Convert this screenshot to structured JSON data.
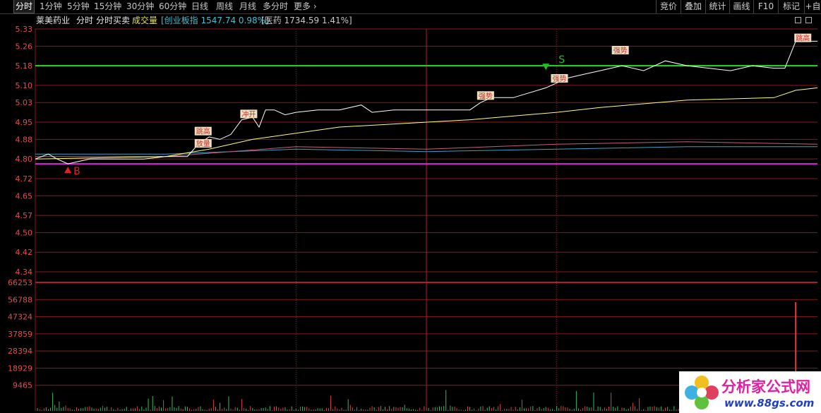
{
  "toolbar": {
    "periods": [
      "分时",
      "1分钟",
      "5分钟",
      "15分钟",
      "30分钟",
      "60分钟",
      "日线",
      "周线",
      "月线",
      "多分时",
      "更多"
    ],
    "right_tools": [
      "竞价",
      "叠加",
      "统计",
      "画线",
      "F10",
      "标记",
      "+自"
    ]
  },
  "info": {
    "stock_name": "莱美药业",
    "tab_time": "分时",
    "tab_trade": "分时买卖",
    "volume_label": "成交量",
    "index1": "[创业板指 1547.74 0.98%]",
    "index2": "[医药 1734.59 1.41%]"
  },
  "price_axis": [
    "5.33",
    "5.26",
    "5.18",
    "5.10",
    "5.03",
    "4.95",
    "4.88",
    "4.80",
    "4.72",
    "4.65",
    "4.57",
    "4.50",
    "4.42",
    "4.34"
  ],
  "volume_axis": [
    "66253",
    "56788",
    "47324",
    "37859",
    "28394",
    "18929",
    "9465"
  ],
  "markers": {
    "buy": "B",
    "sell": "S",
    "labels": [
      "放量",
      "跳高",
      "冲开",
      "强势",
      "强势",
      "强势",
      "跳高"
    ]
  },
  "watermark": {
    "title": "分析家公式网",
    "url": "www.88gs.com"
  },
  "colors": {
    "grid": "#8b1a1a",
    "price_line": "#ffffff",
    "avg_line": "#ffff80",
    "green_level": "#22dd22",
    "magenta_level": "#dd22dd",
    "axis_text": "#e05050"
  },
  "chart_data": {
    "type": "line",
    "title": "",
    "y_range": [
      4.34,
      5.33
    ],
    "price_series": [
      [
        0,
        4.8
      ],
      [
        6,
        4.82
      ],
      [
        10,
        4.8
      ],
      [
        15,
        4.78
      ],
      [
        20,
        4.79
      ],
      [
        25,
        4.8
      ],
      [
        30,
        4.8
      ],
      [
        40,
        4.8
      ],
      [
        50,
        4.8
      ],
      [
        60,
        4.81
      ],
      [
        70,
        4.81
      ],
      [
        75,
        4.86
      ],
      [
        80,
        4.89
      ],
      [
        85,
        4.88
      ],
      [
        90,
        4.9
      ],
      [
        95,
        4.96
      ],
      [
        100,
        4.97
      ],
      [
        103,
        4.93
      ],
      [
        106,
        5.0
      ],
      [
        110,
        5.0
      ],
      [
        115,
        4.98
      ],
      [
        120,
        4.99
      ],
      [
        130,
        5.0
      ],
      [
        140,
        5.0
      ],
      [
        150,
        5.02
      ],
      [
        155,
        4.99
      ],
      [
        165,
        5.0
      ],
      [
        175,
        5.0
      ],
      [
        190,
        5.0
      ],
      [
        200,
        5.0
      ],
      [
        205,
        5.03
      ],
      [
        210,
        5.05
      ],
      [
        220,
        5.05
      ],
      [
        235,
        5.09
      ],
      [
        245,
        5.13
      ],
      [
        255,
        5.15
      ],
      [
        260,
        5.16
      ],
      [
        270,
        5.18
      ],
      [
        280,
        5.16
      ],
      [
        290,
        5.2
      ],
      [
        300,
        5.18
      ],
      [
        310,
        5.17
      ],
      [
        320,
        5.16
      ],
      [
        330,
        5.18
      ],
      [
        340,
        5.17
      ],
      [
        345,
        5.17
      ],
      [
        350,
        5.28
      ],
      [
        355,
        5.28
      ],
      [
        360,
        5.28
      ]
    ],
    "avg_series": [
      [
        0,
        4.8
      ],
      [
        60,
        4.81
      ],
      [
        80,
        4.84
      ],
      [
        100,
        4.88
      ],
      [
        140,
        4.93
      ],
      [
        200,
        4.96
      ],
      [
        240,
        4.99
      ],
      [
        260,
        5.01
      ],
      [
        300,
        5.04
      ],
      [
        340,
        5.05
      ],
      [
        350,
        5.08
      ],
      [
        360,
        5.09
      ]
    ],
    "index_series_1": [
      [
        0,
        4.82
      ],
      [
        60,
        4.82
      ],
      [
        120,
        4.84
      ],
      [
        180,
        4.83
      ],
      [
        240,
        4.84
      ],
      [
        300,
        4.85
      ],
      [
        360,
        4.85
      ]
    ],
    "index_series_2": [
      [
        0,
        4.81
      ],
      [
        60,
        4.81
      ],
      [
        120,
        4.85
      ],
      [
        180,
        4.84
      ],
      [
        240,
        4.86
      ],
      [
        300,
        4.87
      ],
      [
        360,
        4.86
      ]
    ],
    "levels": {
      "green": 5.18,
      "magenta": 4.78
    },
    "volume_max_label": 66253,
    "volume_spike": [
      {
        "t": 350,
        "v": 60000
      }
    ]
  }
}
